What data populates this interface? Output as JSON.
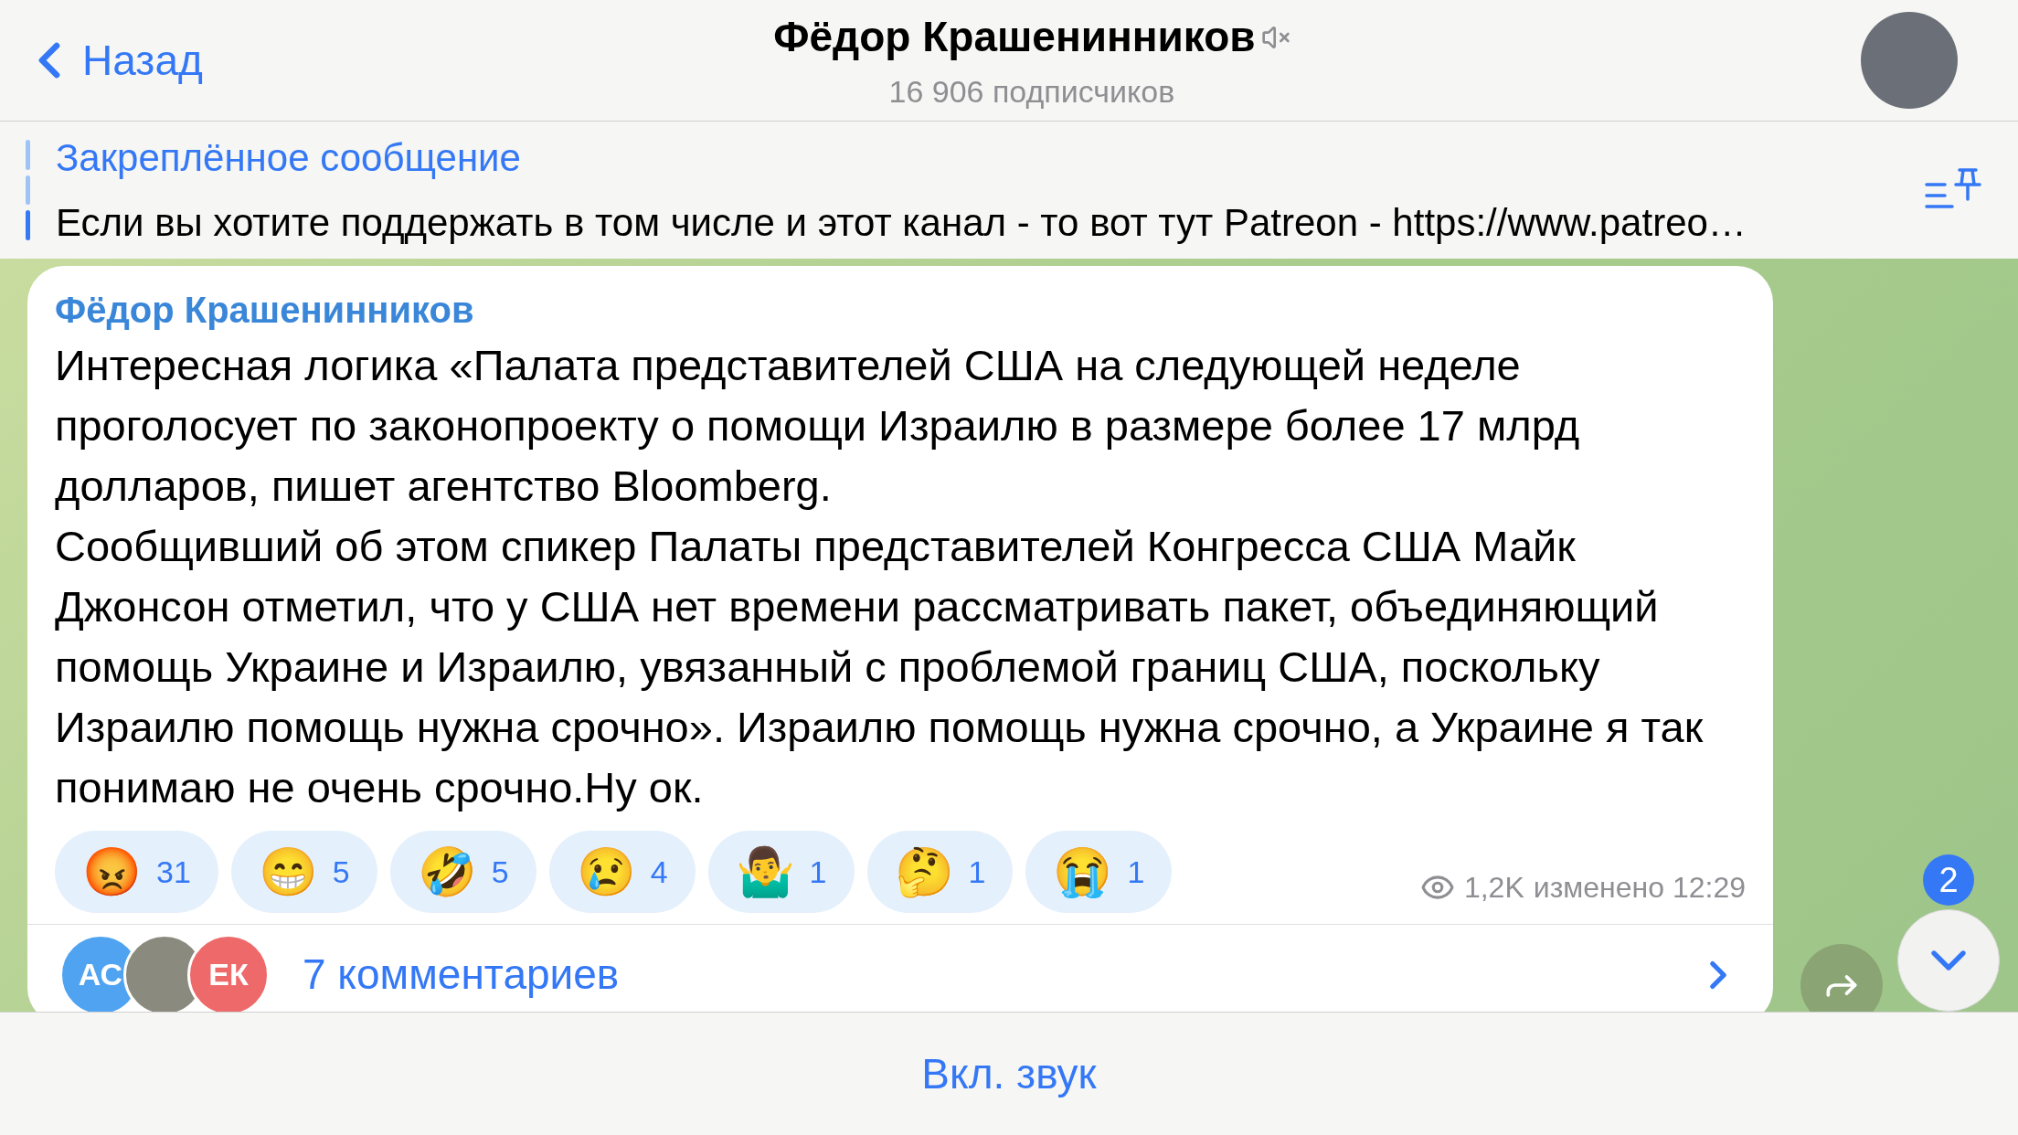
{
  "header": {
    "back": "Назад",
    "title": "Фёдор Крашенинников",
    "muted": true,
    "subtitle": "16 906 подписчиков"
  },
  "pinned": {
    "title": "Закреплённое сообщение",
    "text": "Если вы хотите поддержать в том числе и этот канал - то вот тут Patreon - https://www.patreo…"
  },
  "message": {
    "author": "Фёдор Крашенинников",
    "paragraphs": [
      "Интересная логика «Палата представителей США на следующей неделе проголосует по законопроекту о помощи Израилю в размере более 17 млрд долларов, пишет агентство Bloomberg.",
      "Сообщивший об этом спикер Палаты представителей Конгресса США Майк Джонсон отметил, что у США нет времени рассматривать пакет, объединяющий помощь Украине и Израилю, увязанный с проблемой границ США, поскольку Израилю помощь нужна срочно». Израилю помощь нужна срочно, а Украине я так понимаю не очень срочно.Ну ок."
    ],
    "reactions": [
      {
        "emoji": "😡",
        "count": "31"
      },
      {
        "emoji": "😁",
        "count": "5"
      },
      {
        "emoji": "🤣",
        "count": "5"
      },
      {
        "emoji": "😢",
        "count": "4"
      },
      {
        "emoji": "🤷‍♂️",
        "count": "1"
      },
      {
        "emoji": "🤔",
        "count": "1"
      },
      {
        "emoji": "😭",
        "count": "1"
      }
    ],
    "views": "1,2K",
    "meta": "изменено 12:29",
    "commenters": [
      {
        "kind": "initials",
        "text": "АС",
        "color": "#4fa3f0"
      },
      {
        "kind": "photo"
      },
      {
        "kind": "initials",
        "text": "ЕК",
        "color": "#ee6a6a"
      }
    ],
    "comments": "7 комментариев"
  },
  "scroll_badge": "2",
  "bottom_button": "Вкл. звук"
}
